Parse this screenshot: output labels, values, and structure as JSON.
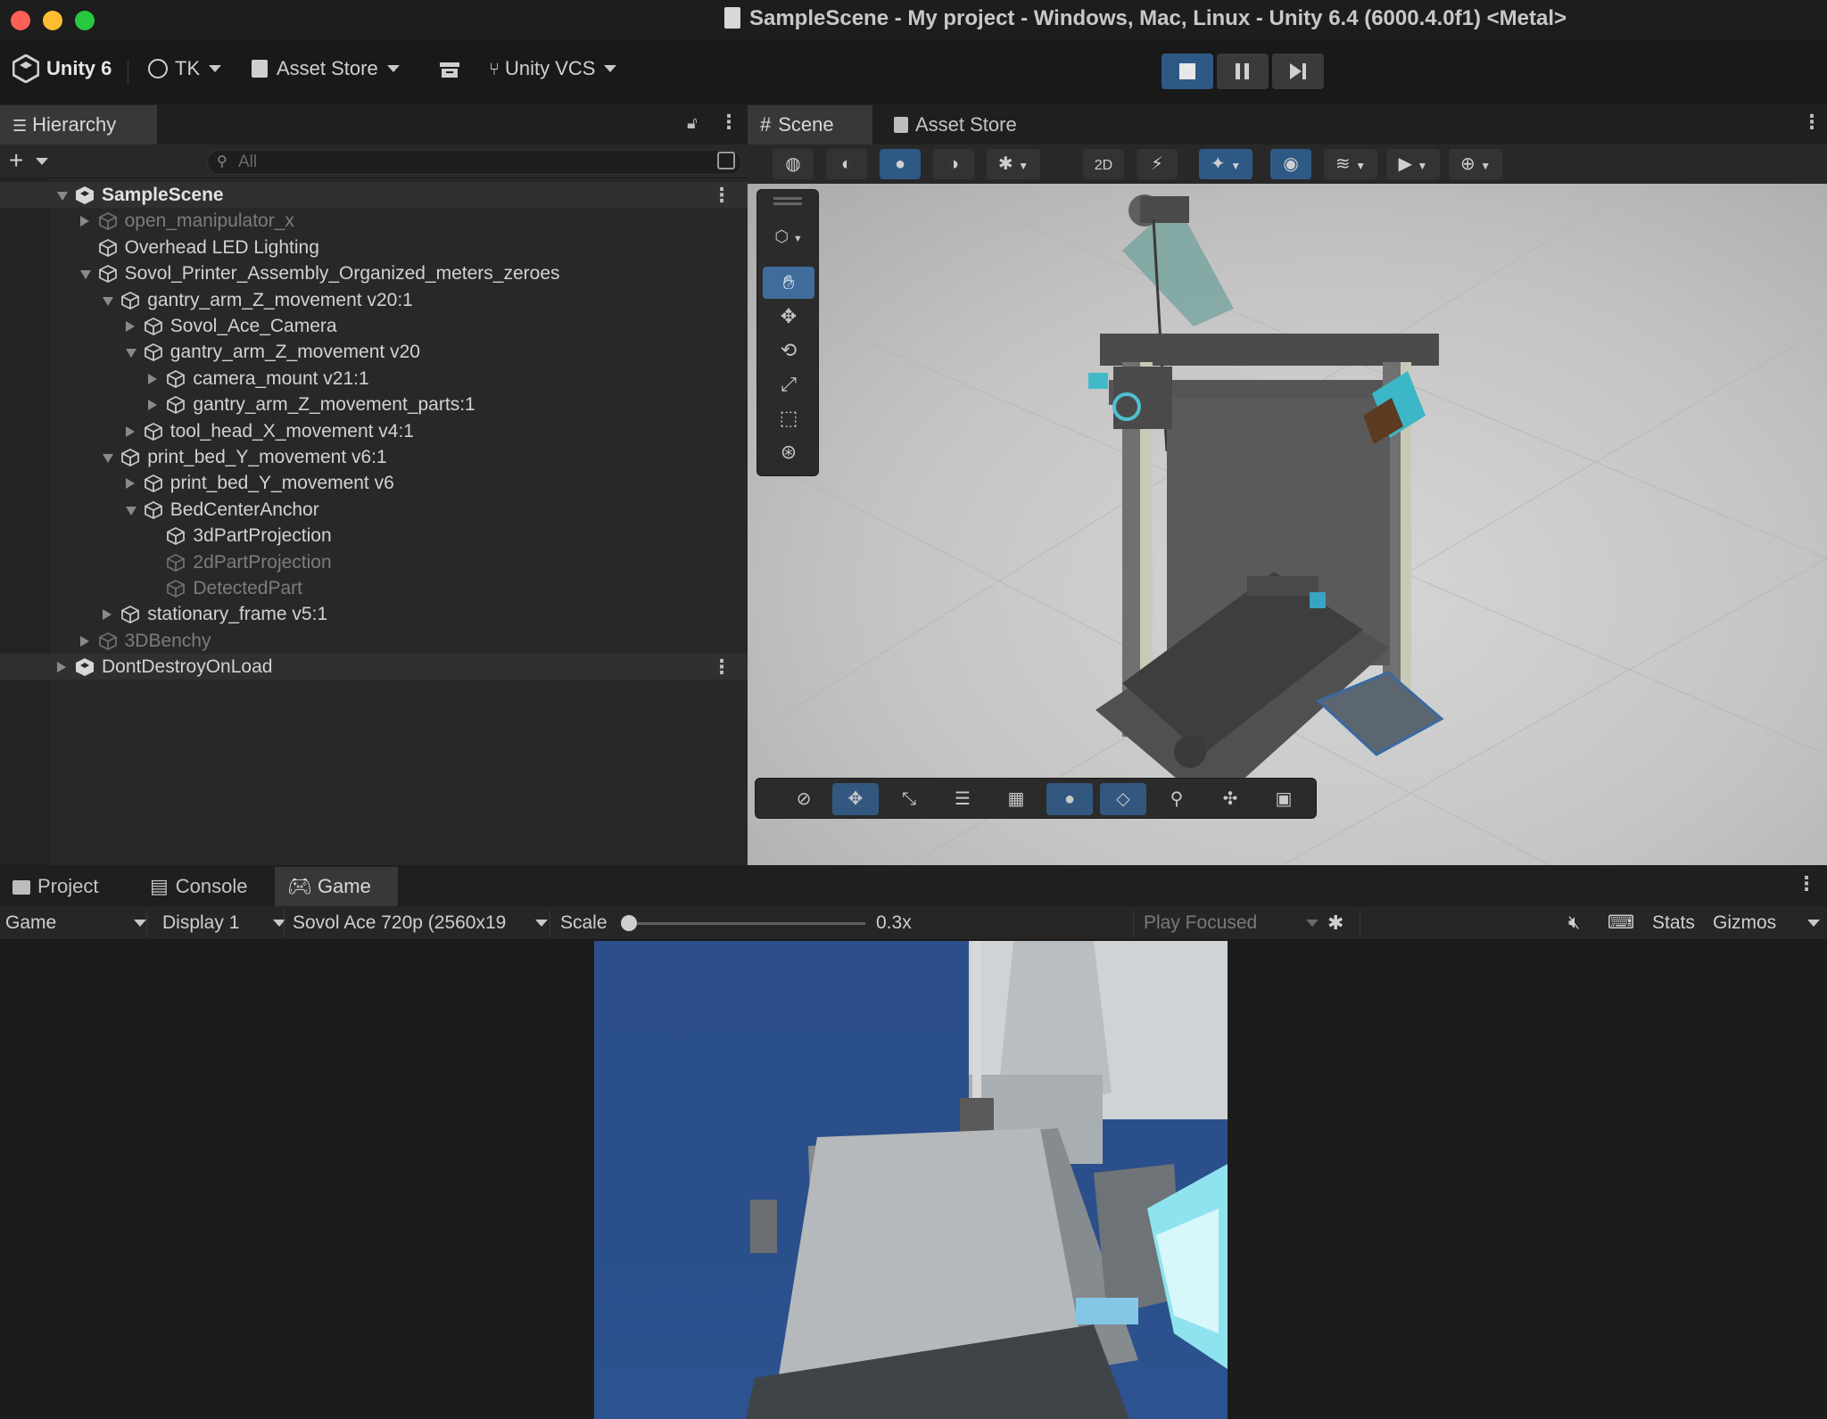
{
  "window": {
    "title": "SampleScene - My project - Windows, Mac, Linux - Unity 6.4 (6000.4.0f1) <Metal>",
    "traffic_colors": [
      "#fe5f57",
      "#febc2e",
      "#28c840"
    ]
  },
  "toolbar": {
    "product": "Unity 6",
    "account": "TK",
    "asset_store": "Asset Store",
    "vcs": "Unity VCS",
    "play_icons": [
      "stop-icon",
      "pause-icon",
      "step-icon"
    ],
    "accent": "#2e5985"
  },
  "hierarchy": {
    "tab_label": "Hierarchy",
    "search_placeholder": "All",
    "rows": [
      {
        "label": "SampleScene",
        "depth": 0,
        "state": "expanded",
        "style": "scene"
      },
      {
        "label": "open_manipulator_x",
        "depth": 1,
        "state": "collapsed",
        "style": "dim"
      },
      {
        "label": "Overhead LED Lighting",
        "depth": 1,
        "state": "leaf",
        "style": "normal"
      },
      {
        "label": "Sovol_Printer_Assembly_Organized_meters_zeroes",
        "depth": 1,
        "state": "expanded",
        "style": "normal"
      },
      {
        "label": "gantry_arm_Z_movement v20:1",
        "depth": 2,
        "state": "expanded",
        "style": "normal"
      },
      {
        "label": "Sovol_Ace_Camera",
        "depth": 3,
        "state": "collapsed",
        "style": "normal"
      },
      {
        "label": "gantry_arm_Z_movement v20",
        "depth": 3,
        "state": "expanded",
        "style": "normal"
      },
      {
        "label": "camera_mount v21:1",
        "depth": 4,
        "state": "collapsed",
        "style": "normal"
      },
      {
        "label": "gantry_arm_Z_movement_parts:1",
        "depth": 4,
        "state": "collapsed",
        "style": "normal"
      },
      {
        "label": "tool_head_X_movement v4:1",
        "depth": 3,
        "state": "collapsed",
        "style": "normal"
      },
      {
        "label": "print_bed_Y_movement v6:1",
        "depth": 2,
        "state": "expanded",
        "style": "normal"
      },
      {
        "label": "print_bed_Y_movement v6",
        "depth": 3,
        "state": "collapsed",
        "style": "normal"
      },
      {
        "label": "BedCenterAnchor",
        "depth": 3,
        "state": "expanded",
        "style": "normal"
      },
      {
        "label": "3dPartProjection",
        "depth": 4,
        "state": "leaf",
        "style": "normal"
      },
      {
        "label": "2dPartProjection",
        "depth": 4,
        "state": "leaf",
        "style": "dim"
      },
      {
        "label": "DetectedPart",
        "depth": 4,
        "state": "leaf",
        "style": "dim"
      },
      {
        "label": "stationary_frame v5:1",
        "depth": 2,
        "state": "collapsed",
        "style": "normal"
      },
      {
        "label": "3DBenchy",
        "depth": 1,
        "state": "collapsed",
        "style": "dim"
      },
      {
        "label": "DontDestroyOnLoad",
        "depth": 0,
        "state": "collapsed",
        "style": "scene"
      }
    ]
  },
  "scene": {
    "tabs": [
      "Scene",
      "Asset Store"
    ],
    "active_tab": "Scene"
  },
  "bottom": {
    "tabs": [
      "Project",
      "Console",
      "Game"
    ],
    "active_tab": "Game",
    "game_bar": {
      "view_select": "Game",
      "display_select": "Display 1",
      "resolution_select": "Sovol Ace 720p (2560x19",
      "scale_label": "Scale",
      "scale_value": "0.3x",
      "scale_level": 0.0,
      "play_mode": "Play Focused",
      "stats": "Stats",
      "gizmos": "Gizmos"
    }
  }
}
